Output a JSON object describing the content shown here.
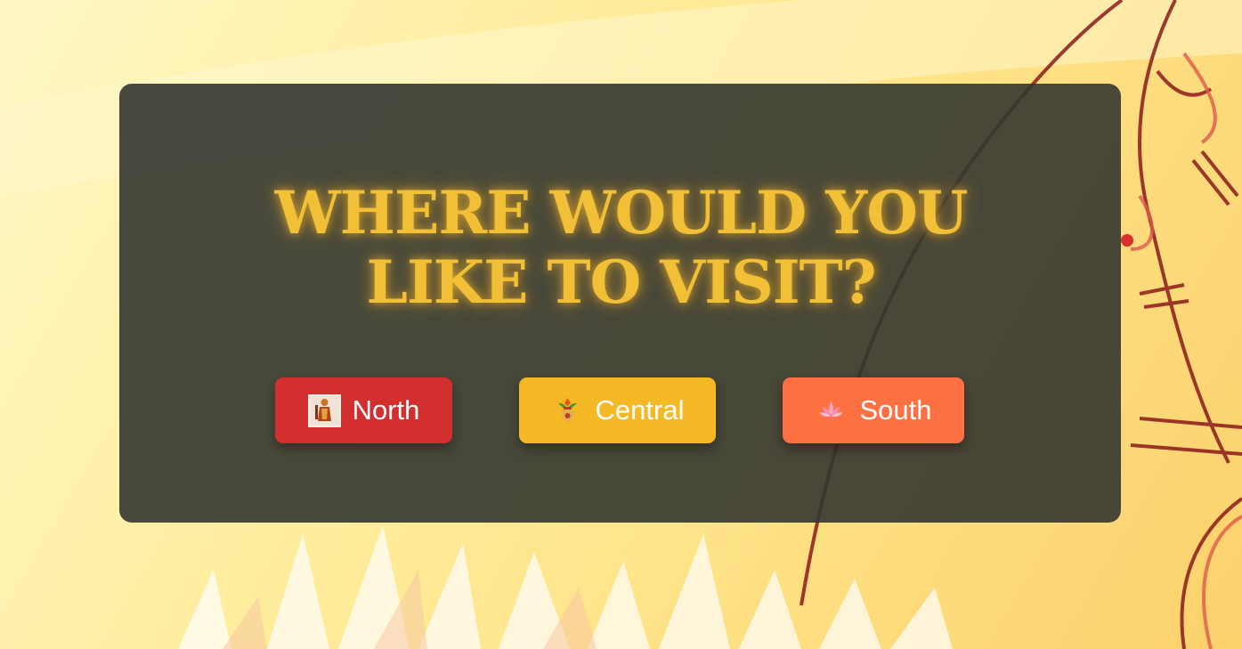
{
  "page": {
    "title_line1": "WHERE WOULD YOU",
    "title_line2": "LIKE TO VISIT?"
  },
  "buttons": [
    {
      "label": "North",
      "icon": "deity-idol-icon",
      "color": "#d32f2f"
    },
    {
      "label": "Central",
      "icon": "kalash-pot-icon",
      "color": "#f4b925"
    },
    {
      "label": "South",
      "icon": "lotus-icon",
      "color": "#ff7043"
    }
  ],
  "colors": {
    "title": "#f2c037",
    "panel": "#343630",
    "background": "#ffe48a"
  }
}
